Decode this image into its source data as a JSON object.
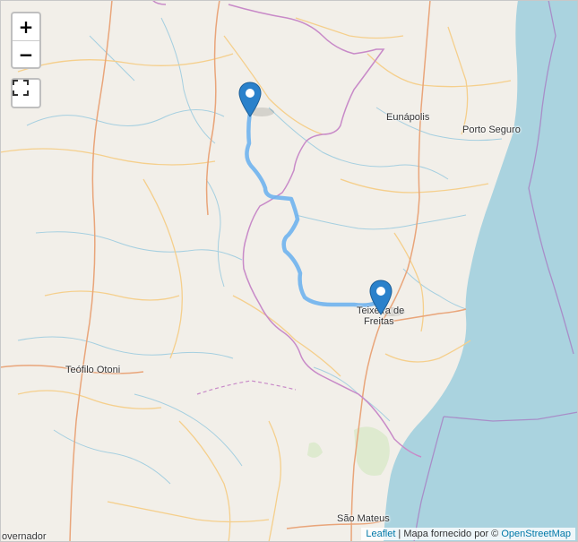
{
  "map": {
    "places": {
      "eunapolis": "Eunápolis",
      "porto_seguro": "Porto Seguro",
      "teixeira_line1": "Teixeira de",
      "teixeira_line2": "Freitas",
      "teofilo_otoni": "Teófilo Otoni",
      "sao_mateus": "São Mateus",
      "governador": "overnador"
    },
    "colors": {
      "land": "#f2efe9",
      "water": "#aad3df",
      "route": "#6fb2ee",
      "state_border": "#c88ac8",
      "road_major": "#e9a57a",
      "road_minor": "#f5cf8c",
      "river": "#a5cfe0",
      "marker": "#2a81cb"
    }
  },
  "controls": {
    "zoom_in": "+",
    "zoom_out": "−",
    "fullscreen_icon": "fullscreen-icon"
  },
  "markers": [
    {
      "name": "route-start-marker",
      "icon": "map-pin-icon"
    },
    {
      "name": "route-end-marker",
      "icon": "map-pin-icon"
    }
  ],
  "attribution": {
    "leaflet_link": "Leaflet",
    "separator": " | Mapa fornecido por © ",
    "osm_link": "OpenStreetMap"
  }
}
